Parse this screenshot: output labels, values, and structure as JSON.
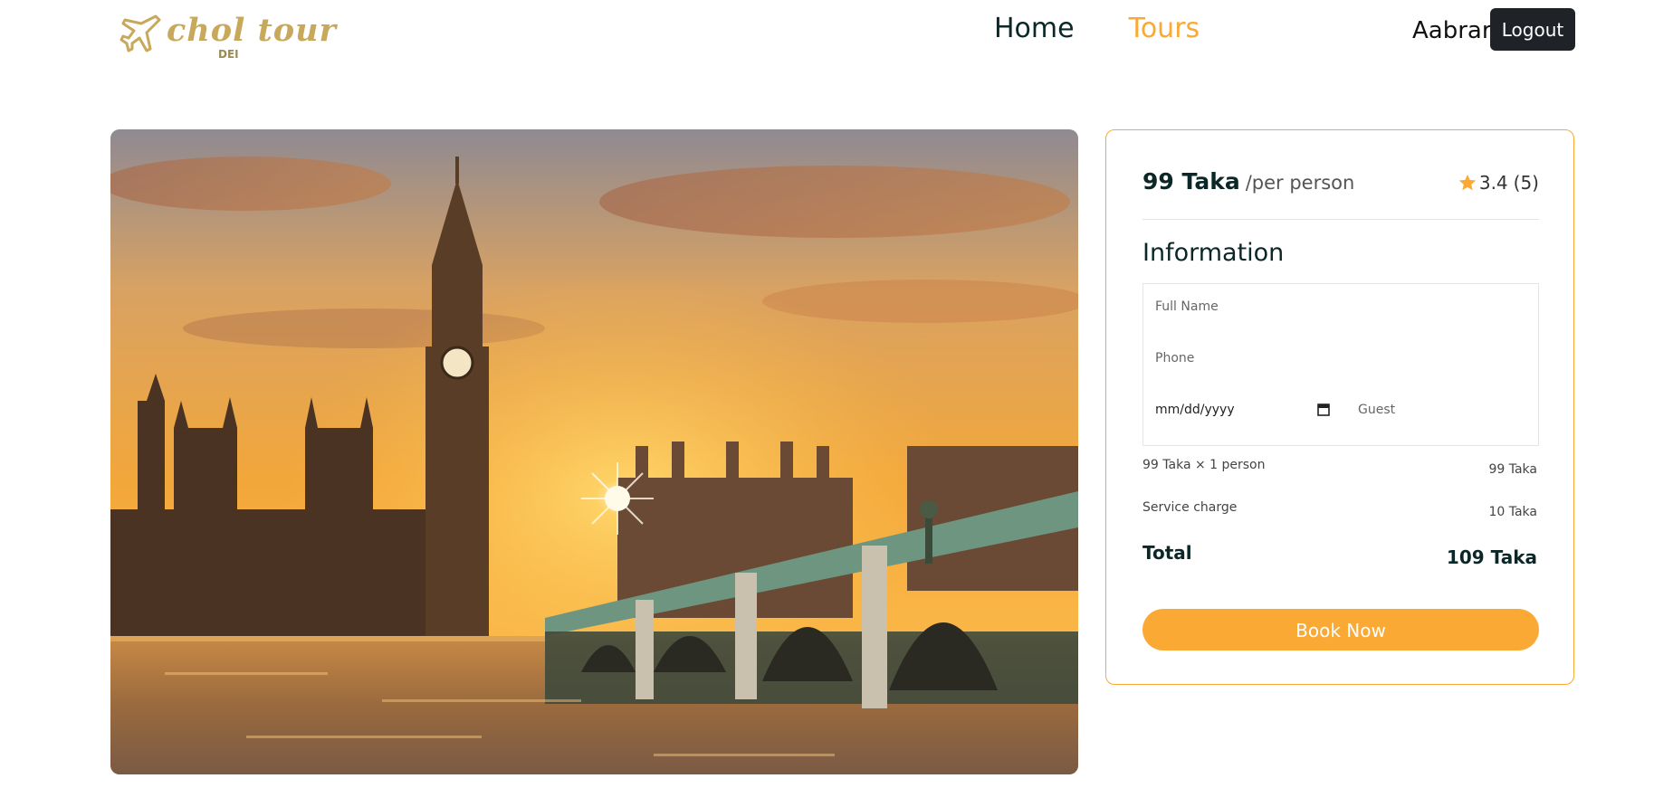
{
  "header": {
    "logo_text": "chol tour",
    "logo_sub": "DEI",
    "nav": {
      "home": "Home",
      "tours": "Tours"
    },
    "username": "Aabrar",
    "logout_label": "Logout"
  },
  "booking": {
    "price": "99 Taka",
    "per_person": "/per person",
    "rating": "3.4",
    "reviews": "(5)",
    "info_title": "Information",
    "form": {
      "full_name_placeholder": "Full Name",
      "phone_placeholder": "Phone",
      "date_placeholder": "mm/dd/yyyy",
      "guest_placeholder": "Guest"
    },
    "calc": {
      "price_times": "99 Taka  ×  1 person",
      "price_total": "99 Taka",
      "service_label": "Service charge",
      "service_value": "10 Taka",
      "total_label": "Total",
      "total_value": "109 Taka"
    },
    "book_label": "Book Now"
  },
  "colors": {
    "accent": "#faa935",
    "heading": "#0b2727",
    "logout_bg": "#1f2328",
    "logo": "#c8a85a"
  },
  "icons": {
    "logo": "airplane-icon",
    "rating": "star-icon",
    "date": "calendar-icon"
  }
}
